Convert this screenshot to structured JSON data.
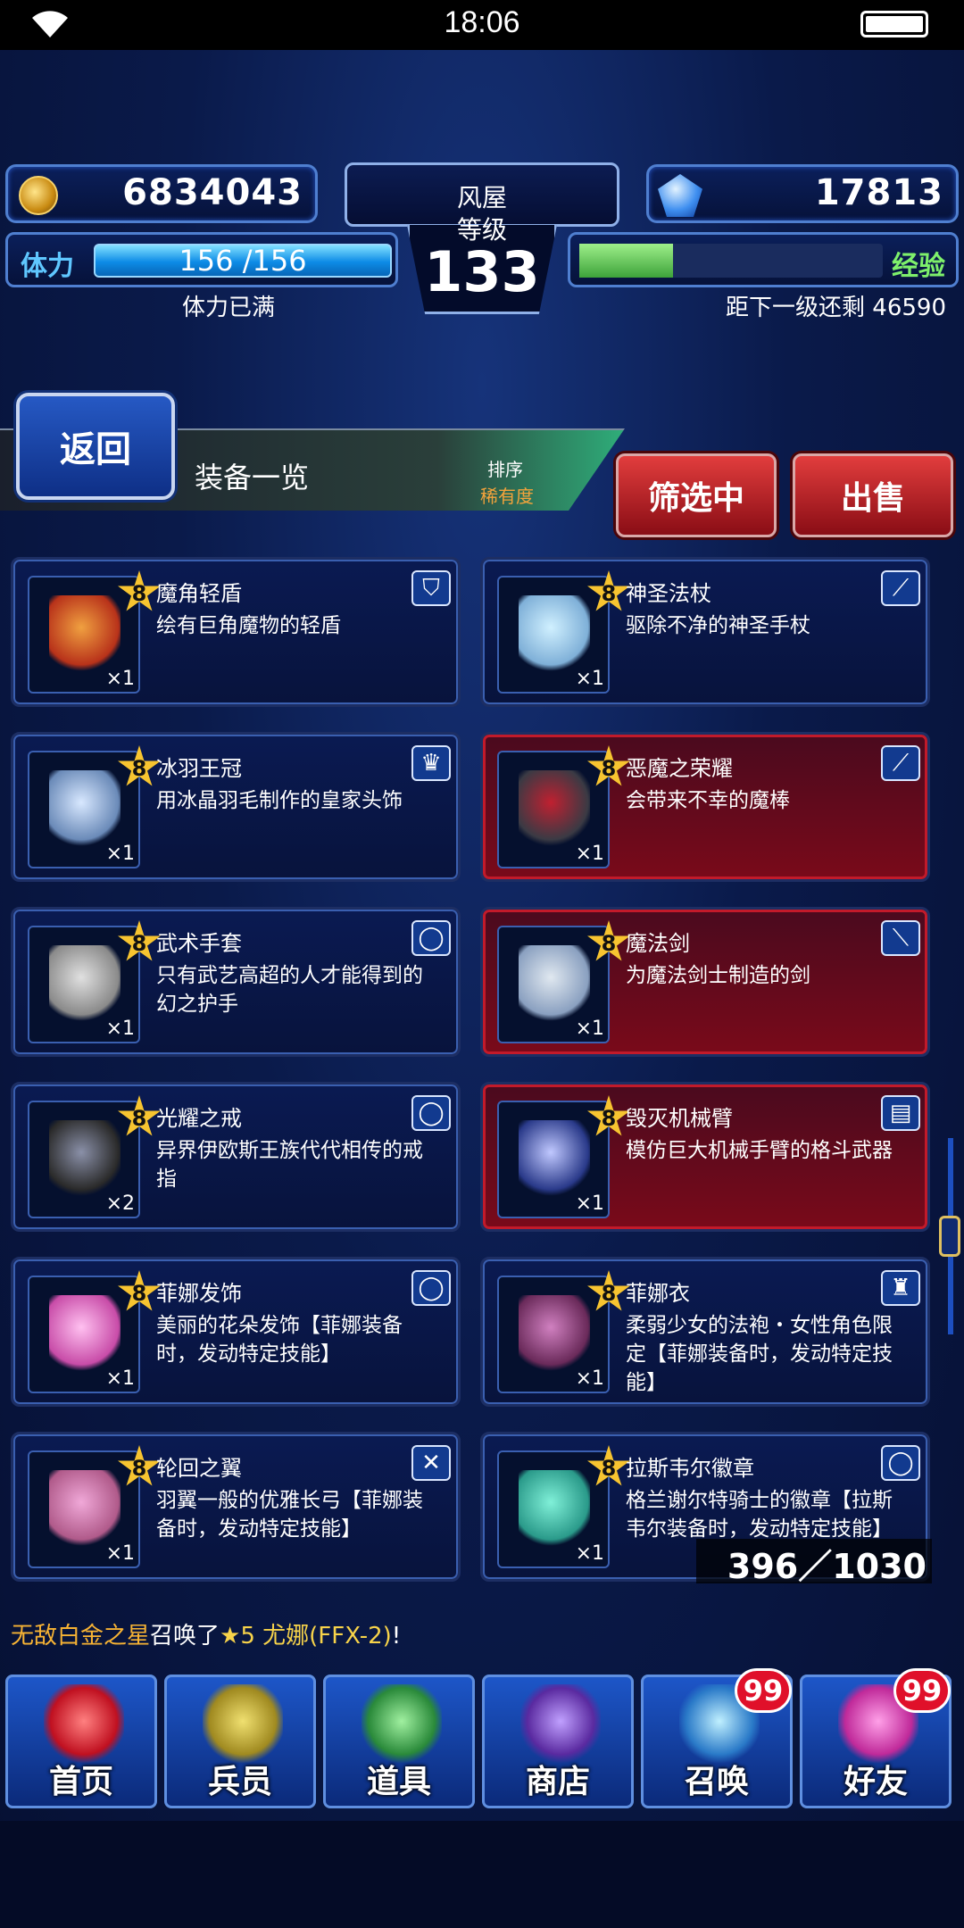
{
  "status": {
    "time": "18:06"
  },
  "header": {
    "gil": "6834043",
    "gems": "17813",
    "stamina_label": "体力",
    "stamina_value": "156 /156",
    "stamina_status": "体力已满",
    "exp_label": "经验",
    "exp_remaining": "距下一级还剩 46590",
    "exp_progress_fraction": 0.31,
    "player_name": "风屋",
    "rank_label": "等级",
    "level": "133"
  },
  "nav": {
    "back_label": "返回",
    "title": "装备一览",
    "sort_label": "排序",
    "sort_value": "稀有度",
    "filter_label": "筛选中",
    "sell_label": "出售"
  },
  "items": [
    {
      "name": "魔角轻盾",
      "desc": "绘有巨角魔物的轻盾",
      "stars": "8",
      "qty": "×1",
      "icon": "shield-icon",
      "highlighted": false
    },
    {
      "name": "神圣法杖",
      "desc": "驱除不净的神圣手杖",
      "stars": "8",
      "qty": "×1",
      "icon": "staff-icon",
      "highlighted": false
    },
    {
      "name": "冰羽王冠",
      "desc": "用冰晶羽毛制作的皇家头饰",
      "stars": "8",
      "qty": "×1",
      "icon": "hat-icon",
      "highlighted": false
    },
    {
      "name": "恶魔之荣耀",
      "desc": "会带来不幸的魔棒",
      "stars": "8",
      "qty": "×1",
      "icon": "rod-icon",
      "highlighted": true
    },
    {
      "name": "武术手套",
      "desc": "只有武艺高超的人才能得到的幻之护手",
      "stars": "8",
      "qty": "×1",
      "icon": "ring-icon",
      "highlighted": false
    },
    {
      "name": "魔法剑",
      "desc": "为魔法剑士制造的剑",
      "stars": "8",
      "qty": "×1",
      "icon": "sword-icon",
      "highlighted": true
    },
    {
      "name": "光耀之戒",
      "desc": "异界伊欧斯王族代代相传的戒指",
      "stars": "8",
      "qty": "×2",
      "icon": "ring-icon",
      "highlighted": false
    },
    {
      "name": "毁灭机械臂",
      "desc": "模仿巨大机械手臂的格斗武器",
      "stars": "8",
      "qty": "×1",
      "icon": "fist-icon",
      "highlighted": true
    },
    {
      "name": "菲娜发饰",
      "desc": "美丽的花朵发饰【菲娜装备时，发动特定技能】",
      "stars": "8",
      "qty": "×1",
      "icon": "ring-icon",
      "highlighted": false
    },
    {
      "name": "菲娜衣",
      "desc": "柔弱少女的法袍・女性角色限定【菲娜装备时，发动特定技能】",
      "stars": "8",
      "qty": "×1",
      "icon": "armor-icon",
      "highlighted": false
    },
    {
      "name": "轮回之翼",
      "desc": "羽翼一般的优雅长弓【菲娜装备时，发动特定技能】",
      "stars": "8",
      "qty": "×1",
      "icon": "bow-icon",
      "highlighted": false
    },
    {
      "name": "拉斯韦尔徽章",
      "desc": "格兰谢尔特骑士的徽章【拉斯韦尔装备时，发动特定技能】",
      "stars": "8",
      "qty": "×1",
      "icon": "ring-icon",
      "highlighted": false
    }
  ],
  "counter": "396／1030",
  "ticker": {
    "who": "无敌白金之星",
    "action": "召唤了",
    "star_text": "★5",
    "unit": " 尤娜(FFX-2)",
    "end": "!"
  },
  "dock": [
    {
      "label": "首页",
      "badge": ""
    },
    {
      "label": "兵员",
      "badge": ""
    },
    {
      "label": "道具",
      "badge": ""
    },
    {
      "label": "商店",
      "badge": ""
    },
    {
      "label": "召唤",
      "badge": "99"
    },
    {
      "label": "好友",
      "badge": "99"
    }
  ]
}
